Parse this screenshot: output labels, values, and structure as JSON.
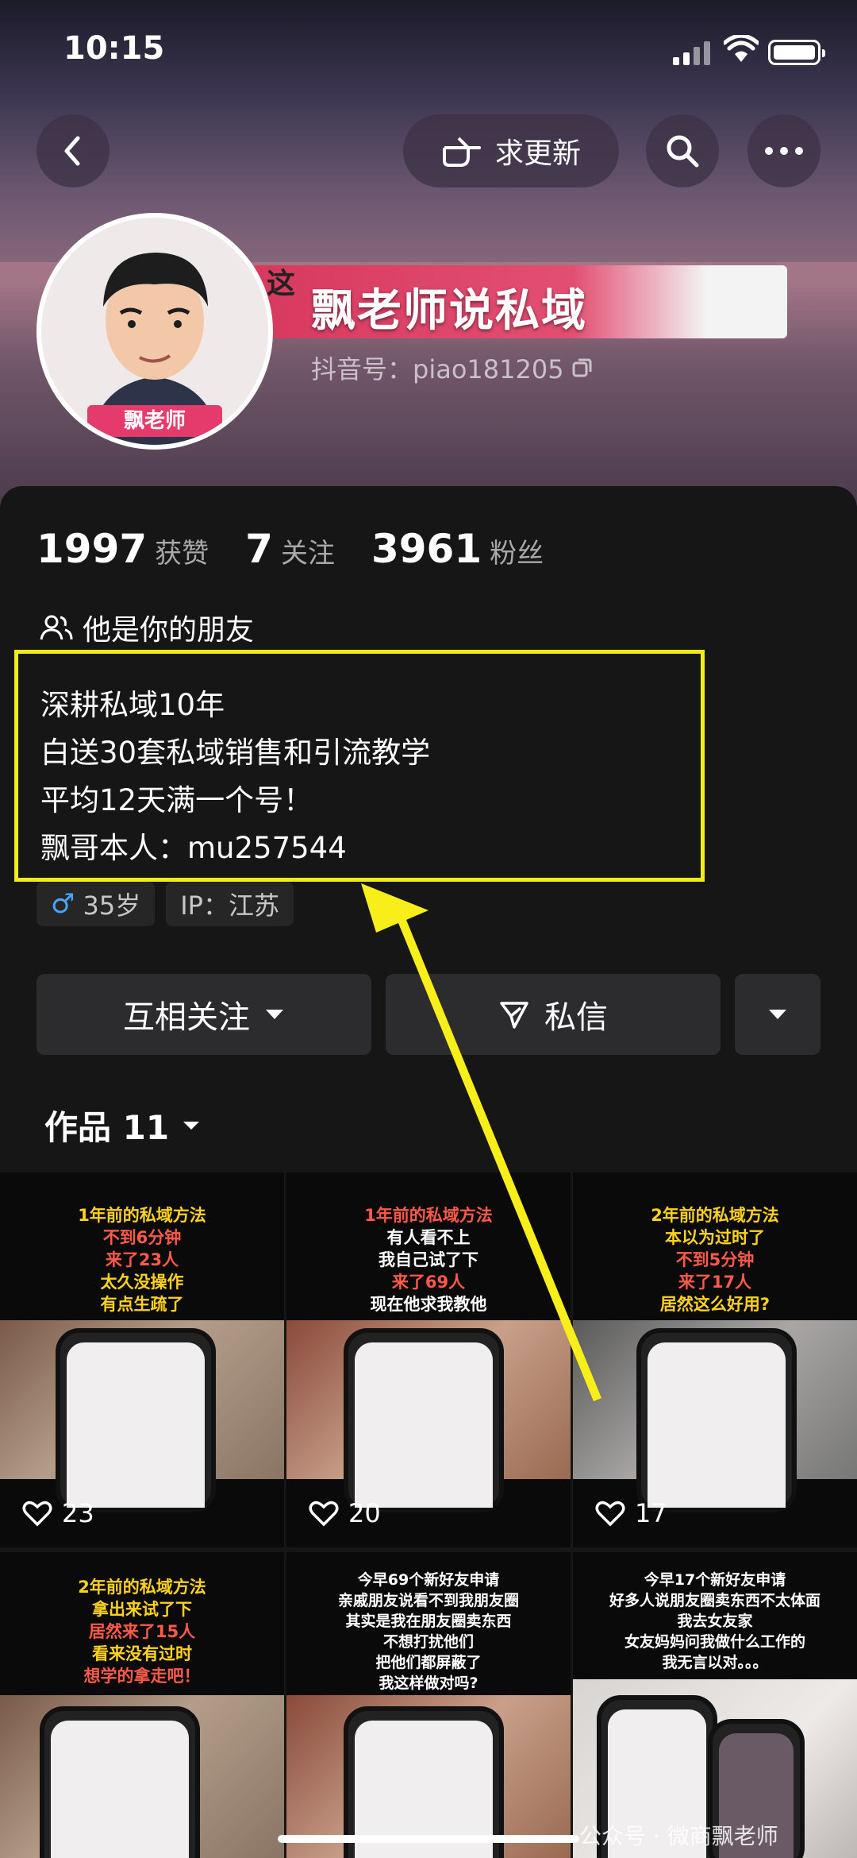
{
  "status_bar": {
    "time": "10:15"
  },
  "header": {
    "update_request_label": "求更新"
  },
  "profile": {
    "banner_text": "这",
    "name": "飘老师说私域",
    "douyin_id": "抖音号：piao181205",
    "avatar_badge": "飘老师",
    "stats": [
      {
        "value": "1997",
        "label": "获赞"
      },
      {
        "value": "7",
        "label": "关注"
      },
      {
        "value": "3961",
        "label": "粉丝"
      }
    ],
    "friend_label": "他是你的朋友",
    "bio_lines": [
      "深耕私域10年",
      "白送30套私域销售和引流教学",
      "平均12天满一个号！",
      "飘哥本人：mu257544"
    ],
    "tags": {
      "age": "35岁",
      "ip": "IP：江苏"
    }
  },
  "actions": {
    "follow_label": "互相关注",
    "message_label": "私信"
  },
  "works": {
    "label": "作品 11"
  },
  "videos": [
    {
      "caption": [
        "1年前的私域方法",
        "不到6分钟",
        "来了23人",
        "太久没操作",
        "有点生疏了"
      ],
      "likes": "23"
    },
    {
      "caption": [
        "1年前的私域方法",
        "有人看不上",
        "我自己试了下",
        "来了69人",
        "现在他求我教他"
      ],
      "likes": "20"
    },
    {
      "caption": [
        "2年前的私域方法",
        "本以为过时了",
        "不到5分钟",
        "来了17人",
        "居然这么好用?"
      ],
      "likes": "17"
    },
    {
      "caption": [
        "2年前的私域方法",
        "拿出来试了下",
        "居然来了15人",
        "看来没有过时",
        "想学的拿走吧！"
      ]
    },
    {
      "caption": [
        "今早69个新好友申请",
        "亲戚朋友说看不到我朋友圈",
        "其实是我在朋友圈卖东西",
        "不想打扰他们",
        "把他们都屏蔽了",
        "我这样做对吗?"
      ]
    },
    {
      "caption": [
        "今早17个新好友申请",
        "好多人说朋友圈卖东西不太体面",
        "我去女友家",
        "女友妈妈问我做什么工作的",
        "我无言以对。。。"
      ]
    }
  ],
  "watermark": "公众号 · 微商飘老师"
}
